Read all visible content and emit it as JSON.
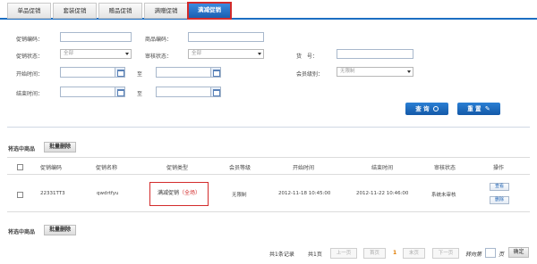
{
  "tabs": [
    {
      "label": "单品促销"
    },
    {
      "label": "套装促销"
    },
    {
      "label": "赠品促销"
    },
    {
      "label": "满赠促销"
    },
    {
      "label": "满减促销"
    }
  ],
  "filters": {
    "promo_code_label": "促销编码：",
    "product_code_label": "商品编码：",
    "promo_status_label": "促销状态：",
    "promo_status_value": "全部",
    "audit_status_label": "审核状态：",
    "audit_status_value": "全部",
    "sku_label": "货　号：",
    "start_time_label": "开始时间：",
    "to_label_1": "至",
    "member_level_label": "会员级别：",
    "member_level_value": "无限制",
    "end_time_label": "结束时间：",
    "to_label_2": "至",
    "query_button": "查 询",
    "reset_button": "重 置"
  },
  "bulk": {
    "selected_label": "将选中商品",
    "delete_button": "批量删除"
  },
  "table": {
    "headers": [
      "促销编码",
      "促销名称",
      "促销类型",
      "会员等级",
      "开始时间",
      "结束时间",
      "审核状态",
      "操作"
    ],
    "rows": [
      {
        "code": "22331TT3",
        "name": "qwdrtfyu",
        "type": "满减促销",
        "scope": "（全场）",
        "level": "无限制",
        "start": "2012-11-18 10:45:00",
        "end": "2012-11-22 10:46:00",
        "status": "系统未审核",
        "view": "查看",
        "delete": "删除"
      }
    ]
  },
  "pager": {
    "total": "共1条记录",
    "pages": "共1页",
    "prev": "上一页",
    "first": "首页",
    "current": "1",
    "last": "末页",
    "next": "下一页",
    "goto": "转向第",
    "page_unit": "页",
    "confirm": "确定"
  },
  "colors": {
    "accent": "#1b6ec2",
    "highlight_border": "#d32b2b",
    "scope_text": "#d32b2b"
  }
}
